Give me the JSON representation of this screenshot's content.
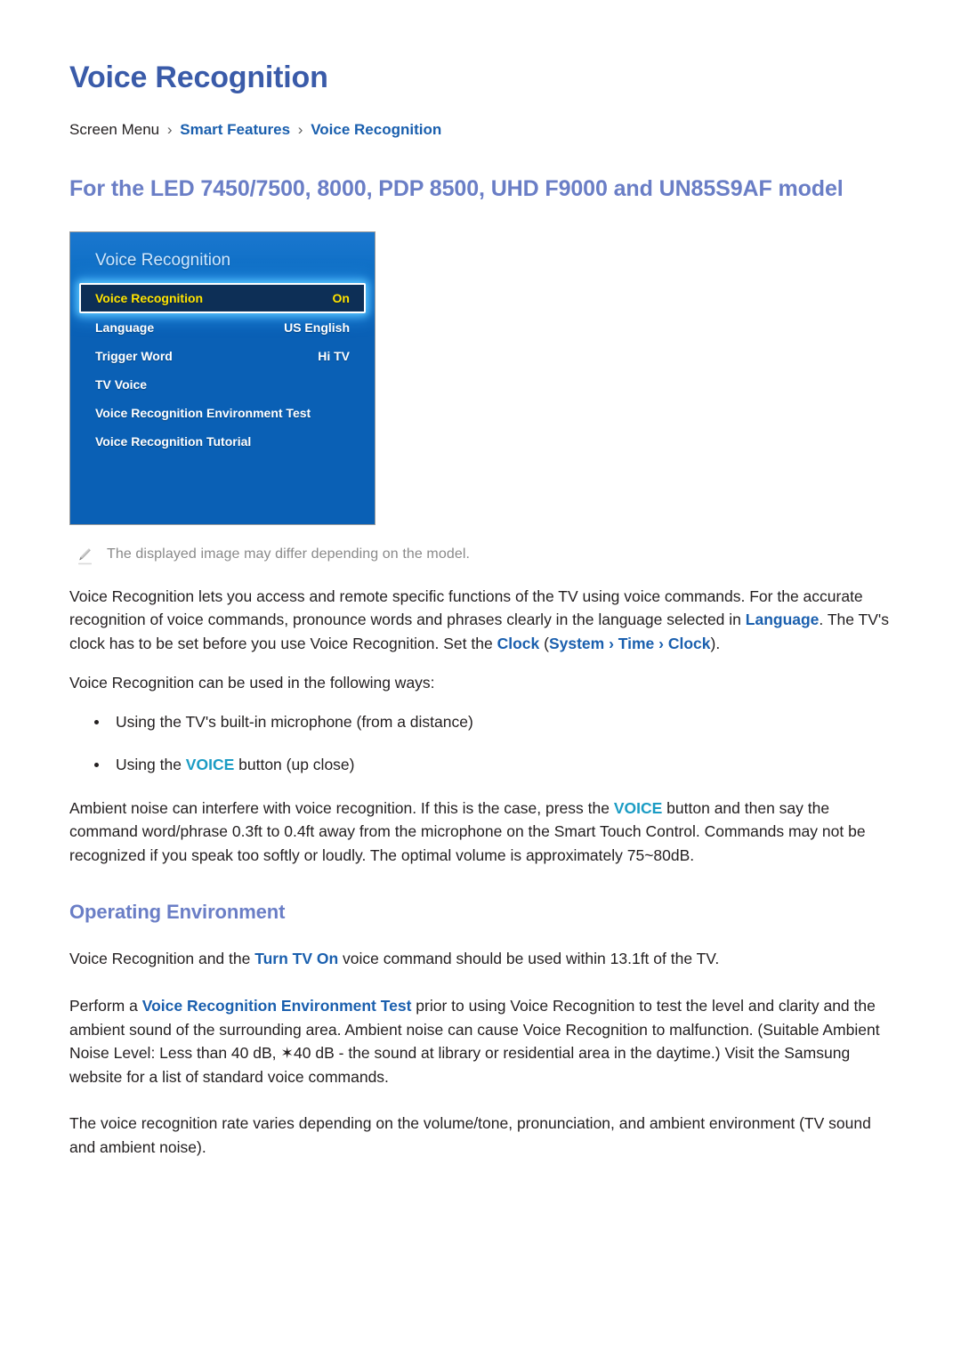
{
  "page": {
    "title": "Voice Recognition"
  },
  "breadcrumb": {
    "root": "Screen Menu",
    "sep": "›",
    "level1": "Smart Features",
    "level2": "Voice Recognition"
  },
  "model_heading": "For the LED 7450/7500, 8000, PDP 8500, UHD F9000 and UN85S9AF model",
  "tv_panel": {
    "title": "Voice Recognition",
    "rows": [
      {
        "label": "Voice Recognition",
        "value": "On",
        "selected": true
      },
      {
        "label": "Language",
        "value": "US English",
        "selected": false
      },
      {
        "label": "Trigger Word",
        "value": "Hi TV",
        "selected": false
      },
      {
        "label": "TV Voice",
        "value": "",
        "selected": false
      },
      {
        "label": "Voice Recognition Environment Test",
        "value": "",
        "selected": false
      },
      {
        "label": "Voice Recognition Tutorial",
        "value": "",
        "selected": false
      }
    ]
  },
  "note": {
    "icon": "pencil-icon",
    "text": "The displayed image may differ depending on the model."
  },
  "intro": {
    "part1": "Voice Recognition lets you access and remote specific functions of the TV using voice commands. For the accurate recognition of voice commands, pronounce words and phrases clearly in the language selected in ",
    "link_language": "Language",
    "part2": ". The TV's clock has to be set before you use Voice Recognition. Set the ",
    "link_clock": "Clock",
    "part3": " (",
    "link_system": "System",
    "sep1": " › ",
    "link_time": "Time",
    "sep2": " › ",
    "link_clock2": "Clock",
    "part4": ")."
  },
  "ways": {
    "lead": "Voice Recognition can be used in the following ways:",
    "items": [
      {
        "pre": "Using the TV's built-in microphone (from a distance)",
        "link": "",
        "post": ""
      },
      {
        "pre": "Using the ",
        "link": "VOICE",
        "post": " button (up close)"
      }
    ]
  },
  "ambient": {
    "part1": "Ambient noise can interfere with voice recognition. If this is the case, press the ",
    "link_voice": "VOICE",
    "part2": " button and then say the command word/phrase 0.3ft to 0.4ft away from the microphone on the Smart Touch Control. Commands may not be recognized if you speak too softly or loudly. The optimal volume is approximately 75~80dB."
  },
  "operating_environment": {
    "heading": "Operating Environment",
    "para1_pre": "Voice Recognition and the ",
    "para1_link": "Turn TV On",
    "para1_post": " voice command should be used within 13.1ft of the TV.",
    "para2_pre": "Perform a ",
    "para2_link": "Voice Recognition Environment Test",
    "para2_post": " prior to using Voice Recognition to test the level and clarity and the ambient sound of the surrounding area. Ambient noise can cause Voice Recognition to malfunction. (Suitable Ambient Noise Level: Less than 40 dB, ✶40 dB - the sound at library or residential area in the daytime.) Visit the Samsung website for a list of standard voice commands.",
    "para3": "The voice recognition rate varies depending on the volume/tone, pronunciation, and ambient environment (TV sound and ambient noise)."
  },
  "colors": {
    "title_blue": "#3a5ba9",
    "link_blue": "#1a5fae",
    "link_cyan": "#1b9cc4",
    "heading_periwinkle": "#6a7ec6",
    "panel_blue": "#0a60b5",
    "selected_yellow": "#ffe400",
    "note_gray": "#8a8a8a"
  }
}
